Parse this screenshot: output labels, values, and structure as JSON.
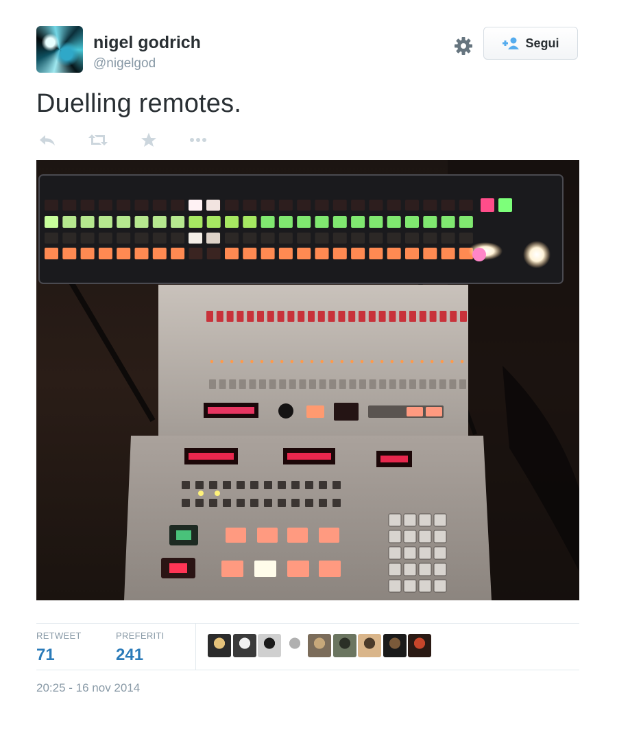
{
  "user": {
    "name": "nigel godrich",
    "handle": "@nigelgod",
    "follow_label": "Segui"
  },
  "tweet": {
    "text": "Duelling remotes.",
    "action_icons": [
      "reply-icon",
      "retweet-icon",
      "favorite-star-icon",
      "more-icon"
    ]
  },
  "photo": {
    "displays": [
      "0.0.1.4.8",
      "0.0.0.0.0",
      "0.0.0.0",
      "15.0.0"
    ]
  },
  "stats": {
    "retweet_label": "RETWEET",
    "retweet_count": "71",
    "favorites_label": "PREFERITI",
    "favorites_count": "241",
    "favoriter_count": 9
  },
  "timestamp": "20:25 - 16 nov 2014",
  "colors": {
    "accent": "#2b7bb9",
    "text": "#292f33",
    "muted": "#8899a6",
    "border": "#e1e8ed"
  }
}
